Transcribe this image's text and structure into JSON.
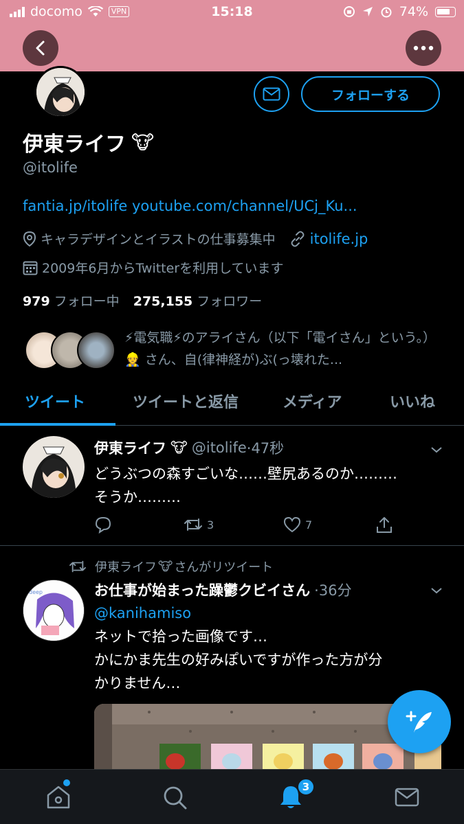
{
  "status_bar": {
    "carrier": "docomo",
    "vpn": "VPN",
    "time": "15:18",
    "battery": "74%"
  },
  "profile": {
    "name": "伊東ライフ",
    "name_emoji": "🐮",
    "handle": "@itolife",
    "follow_button": "フォローする",
    "bio_links": "fantia.jp/itolife youtube.com/channel/UCj_Ku...",
    "location": "キャラデザインとイラストの仕事募集中",
    "website": "itolife.jp",
    "joined": "2009年6月からTwitterを利用しています",
    "following_count": "979",
    "following_label": "フォロー中",
    "followers_count": "275,155",
    "followers_label": "フォロワー",
    "known_followers_text": "⚡電気職⚡のアライさん（以下「電イさん」という。）👷 さん、自(律神経が)ぶ(っ壊れた..."
  },
  "tabs": [
    {
      "label": "ツイート",
      "active": true
    },
    {
      "label": "ツイートと返信",
      "active": false
    },
    {
      "label": "メディア",
      "active": false
    },
    {
      "label": "いいね",
      "active": false
    }
  ],
  "tweets": [
    {
      "name": "伊東ライフ",
      "emoji": "🐮",
      "handle": "@itolife",
      "time": "·47秒",
      "text_line1": "どうぶつの森すごいな……壁尻あるのか………",
      "text_line2": "そうか………",
      "retweets": "3",
      "likes": "7"
    },
    {
      "retweet_by": "伊東ライフ",
      "retweet_emoji": "🐮",
      "retweet_suffix": "さんがリツイート",
      "name": "お仕事が始まった躁鬱クビイさん",
      "time": "·36分",
      "mention": "@kanihamiso",
      "text_line1": "ネットで拾った画像です…",
      "text_line2": "かにかま先生の好みぽいですが作った方が分",
      "text_line3": "かりません…"
    }
  ],
  "tabbar": {
    "notification_count": "3"
  },
  "colors": {
    "accent": "#1da1f2",
    "header_pink": "#e0909f",
    "muted": "#8899a6"
  }
}
